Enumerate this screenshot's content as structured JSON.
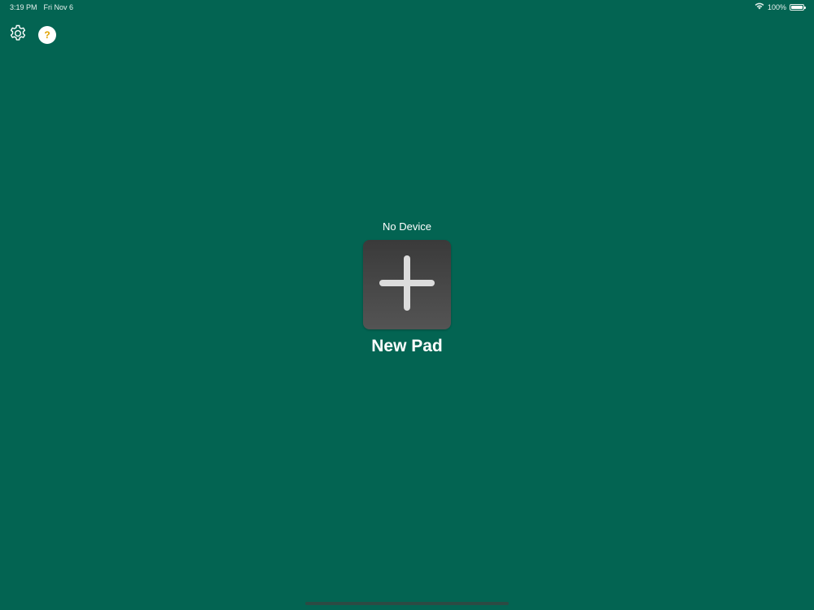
{
  "status_bar": {
    "time": "3:19 PM",
    "date": "Fri Nov 6",
    "battery_text": "100%",
    "battery_level": 1.0,
    "wifi_icon": "wifi-icon",
    "battery_icon": "battery-icon"
  },
  "toolbar": {
    "settings_icon": "gear-icon",
    "help_label": "?"
  },
  "main": {
    "device_label": "No Device",
    "new_pad_icon": "plus-icon",
    "new_pad_label": "New Pad"
  },
  "colors": {
    "background": "#036452",
    "tile_top": "#3a3a3a",
    "tile_bottom": "#545454",
    "help_accent": "#e0a100"
  }
}
